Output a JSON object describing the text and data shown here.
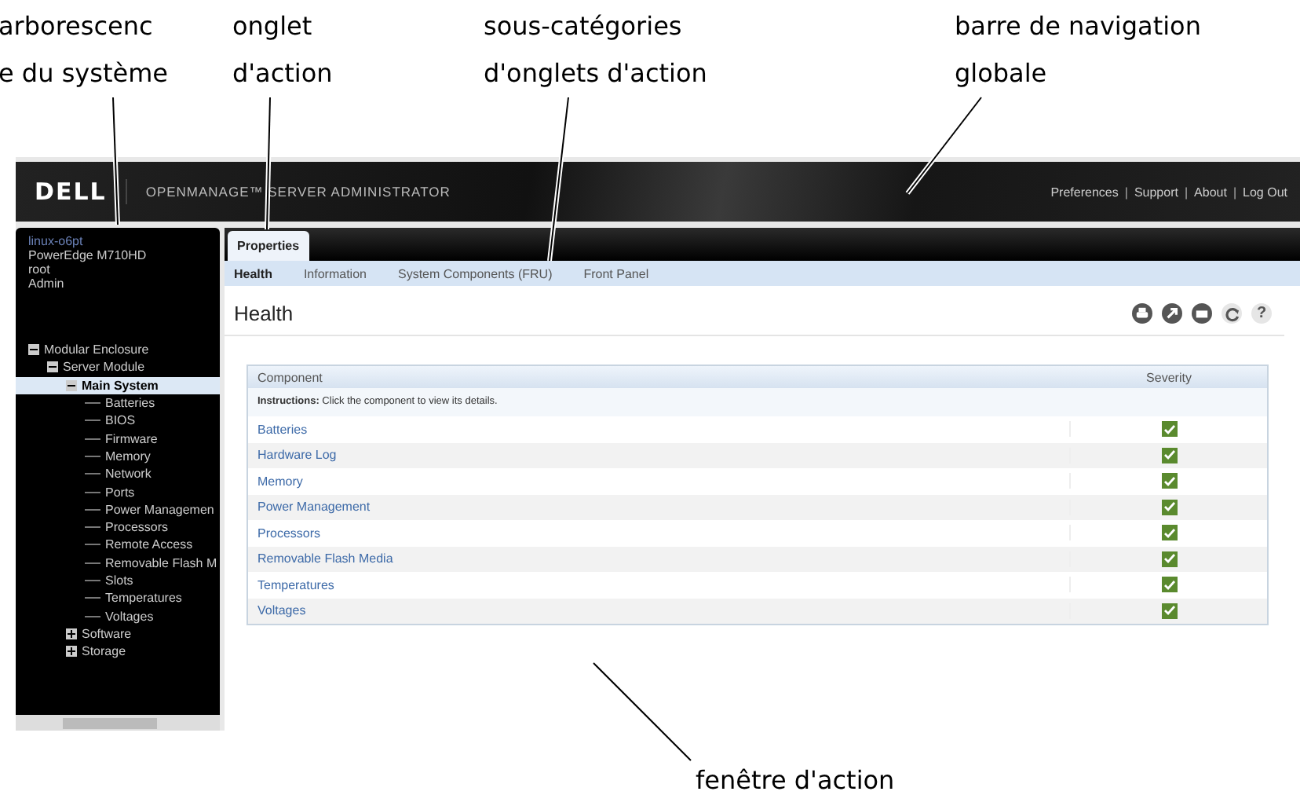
{
  "callouts": [
    {
      "kind": "tree",
      "lines": [
        "arborescenc",
        "e du système"
      ]
    },
    {
      "kind": "tab",
      "lines": [
        "onglet",
        "d'action"
      ]
    },
    {
      "kind": "subtab",
      "lines": [
        "sous-catégories",
        "d'onglets d'action"
      ]
    },
    {
      "kind": "nav",
      "lines": [
        "barre de navigation",
        "globale"
      ]
    },
    {
      "kind": "window",
      "lines": [
        "fenêtre d'action"
      ]
    }
  ],
  "header": {
    "logo": "DELL",
    "title": "OPENMANAGE™ SERVER ADMINISTRATOR",
    "links": [
      "Preferences",
      "Support",
      "About",
      "Log Out"
    ],
    "separator": "|"
  },
  "session": {
    "host": "linux-o6pt",
    "model": "PowerEdge M710HD",
    "user": "root",
    "role": "Admin"
  },
  "tree": [
    {
      "label": "Modular Enclosure",
      "expanded": true,
      "selected": false,
      "children": [
        {
          "label": "Server Module",
          "expanded": true,
          "selected": false,
          "children": [
            {
              "label": "Main System",
              "expanded": true,
              "selected": true,
              "children": [
                {
                  "label": "Batteries",
                  "selected": false
                },
                {
                  "label": "BIOS",
                  "selected": false
                },
                {
                  "label": "Firmware",
                  "selected": false
                },
                {
                  "label": "Memory",
                  "selected": false
                },
                {
                  "label": "Network",
                  "selected": false
                },
                {
                  "label": "Ports",
                  "selected": false
                },
                {
                  "label": "Power Managemen",
                  "selected": false
                },
                {
                  "label": "Processors",
                  "selected": false
                },
                {
                  "label": "Remote Access",
                  "selected": false
                },
                {
                  "label": "Removable Flash M",
                  "selected": false
                },
                {
                  "label": "Slots",
                  "selected": false
                },
                {
                  "label": "Temperatures",
                  "selected": false
                },
                {
                  "label": "Voltages",
                  "selected": false
                }
              ]
            },
            {
              "label": "Software",
              "expanded": false,
              "selected": false
            },
            {
              "label": "Storage",
              "expanded": false,
              "selected": false
            }
          ]
        }
      ]
    }
  ],
  "tabs": [
    {
      "label": "Properties",
      "selected": true
    }
  ],
  "subtabs": [
    {
      "label": "Health",
      "selected": true
    },
    {
      "label": "Information",
      "selected": false
    },
    {
      "label": "System Components (FRU)",
      "selected": false
    },
    {
      "label": "Front Panel",
      "selected": false
    }
  ],
  "page_title": "Health",
  "toolbar": [
    {
      "kind": "print"
    },
    {
      "kind": "export"
    },
    {
      "kind": "email"
    },
    {
      "kind": "refresh"
    },
    {
      "kind": "help",
      "text": "?"
    }
  ],
  "table": {
    "columns": [
      "Component",
      "Severity"
    ],
    "instructions": "**Instructions:** Click the component to view its details.",
    "rows": [
      {
        "component": "Batteries"
      },
      {
        "component": "Hardware Log"
      },
      {
        "component": "Memory"
      },
      {
        "component": "Power Management"
      },
      {
        "component": "Processors"
      },
      {
        "component": "Removable Flash Media"
      },
      {
        "component": "Temperatures"
      },
      {
        "component": "Voltages"
      }
    ]
  }
}
